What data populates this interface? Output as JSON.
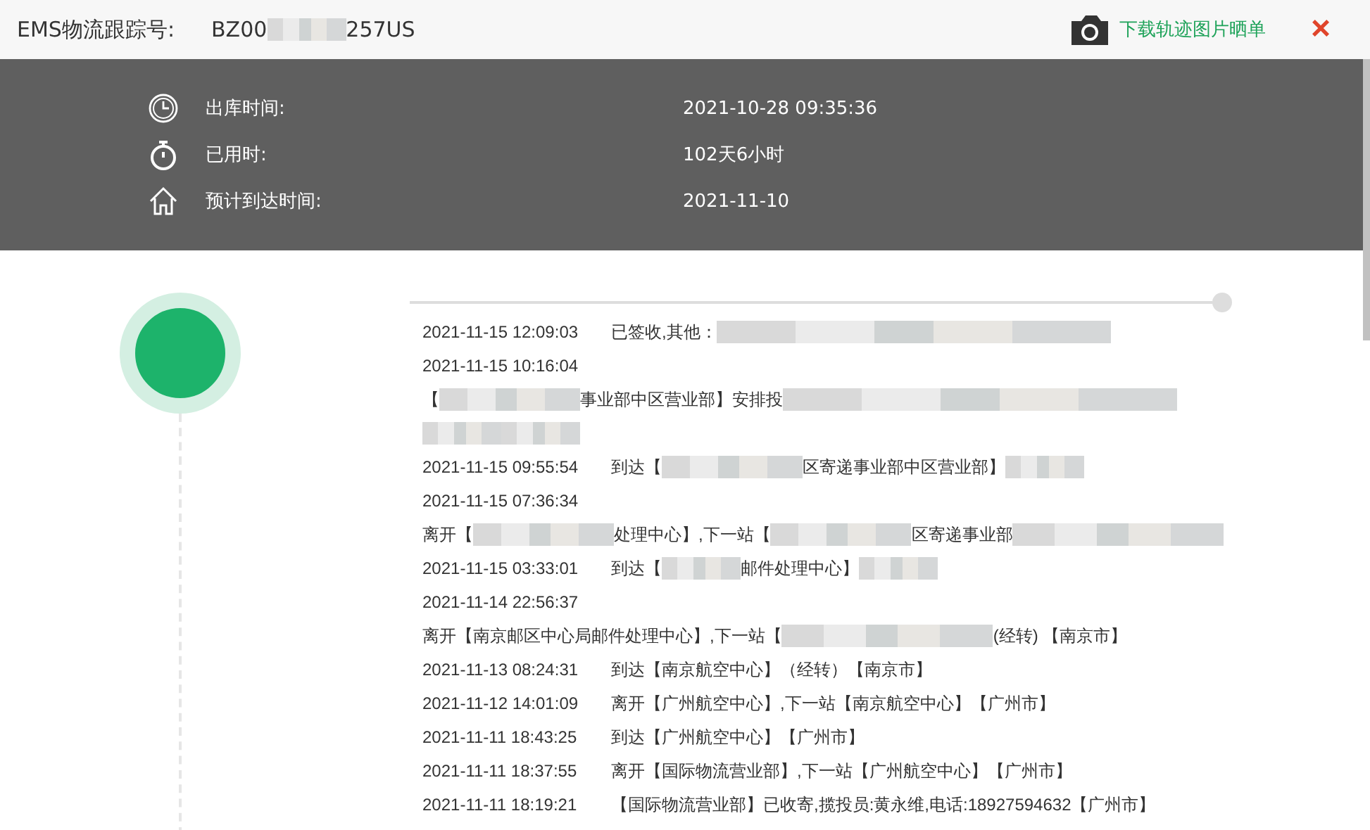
{
  "header": {
    "label": "EMS物流跟踪号:",
    "tracking": [
      {
        "kind": "text",
        "text": "BZ00"
      },
      {
        "kind": "blur_short"
      },
      {
        "kind": "text",
        "text": "257US"
      }
    ],
    "download_link": "下载轨迹图片晒单",
    "close": "×"
  },
  "summary": [
    {
      "label": "出库时间:",
      "value": "2021-10-28 09:35:36"
    },
    {
      "label": "已用时:",
      "value": "102天6小时"
    },
    {
      "label": "预计到达时间:",
      "value": "2021-11-10"
    }
  ],
  "events": [
    {
      "time": "2021-11-15 12:09:03",
      "parts": [
        {
          "kind": "text",
          "text": "已签收,其他："
        },
        {
          "kind": "blur_wide"
        }
      ]
    },
    {
      "time": "2021-11-15 10:16:04"
    },
    {
      "parts": [
        {
          "kind": "text",
          "text": "【"
        },
        {
          "kind": "blur_medium"
        },
        {
          "kind": "text",
          "text": "事业部中区营业部】安排投"
        },
        {
          "kind": "blur_wide"
        }
      ]
    },
    {
      "parts": [
        {
          "kind": "blur_short"
        },
        {
          "kind": "blur_short"
        }
      ]
    },
    {
      "time": "2021-11-15 09:55:54",
      "parts": [
        {
          "kind": "text",
          "text": "到达【"
        },
        {
          "kind": "blur_medium"
        },
        {
          "kind": "text",
          "text": "区寄递事业部中区营业部】"
        },
        {
          "kind": "blur_short"
        }
      ]
    },
    {
      "time": "2021-11-15 07:36:34"
    },
    {
      "parts": [
        {
          "kind": "text",
          "text": "离开【"
        },
        {
          "kind": "blur_medium"
        },
        {
          "kind": "text",
          "text": "处理中心】,下一站【"
        },
        {
          "kind": "blur_medium"
        },
        {
          "kind": "text",
          "text": "区寄递事业部"
        },
        {
          "kind": "blur_long"
        }
      ]
    },
    {
      "time": "2021-11-15 03:33:01",
      "parts": [
        {
          "kind": "text",
          "text": "到达【"
        },
        {
          "kind": "blur_short"
        },
        {
          "kind": "text",
          "text": "邮件处理中心】"
        },
        {
          "kind": "blur_short"
        }
      ]
    },
    {
      "time": "2021-11-14 22:56:37"
    },
    {
      "parts": [
        {
          "kind": "text",
          "text": "离开【南京邮区中心局邮件处理中心】,下一站【"
        },
        {
          "kind": "blur_long"
        },
        {
          "kind": "text",
          "text": "(经转) 【南京市】"
        }
      ]
    },
    {
      "time": "2021-11-13 08:24:31",
      "parts": [
        {
          "kind": "text",
          "text": "到达【南京航空中心】（经转）【南京市】"
        }
      ]
    },
    {
      "time": "2021-11-12 14:01:09",
      "parts": [
        {
          "kind": "text",
          "text": "离开【广州航空中心】,下一站【南京航空中心】【广州市】"
        }
      ]
    },
    {
      "time": "2021-11-11 18:43:25",
      "parts": [
        {
          "kind": "text",
          "text": "到达【广州航空中心】【广州市】"
        }
      ]
    },
    {
      "time": "2021-11-11 18:37:55",
      "parts": [
        {
          "kind": "text",
          "text": "离开【国际物流营业部】,下一站【广州航空中心】【广州市】"
        }
      ]
    },
    {
      "time": "2021-11-11 18:19:21",
      "parts": [
        {
          "kind": "text",
          "text": "【国际物流营业部】已收寄,揽投员:黄永维,电话:18927594632【广州市】"
        }
      ]
    }
  ]
}
